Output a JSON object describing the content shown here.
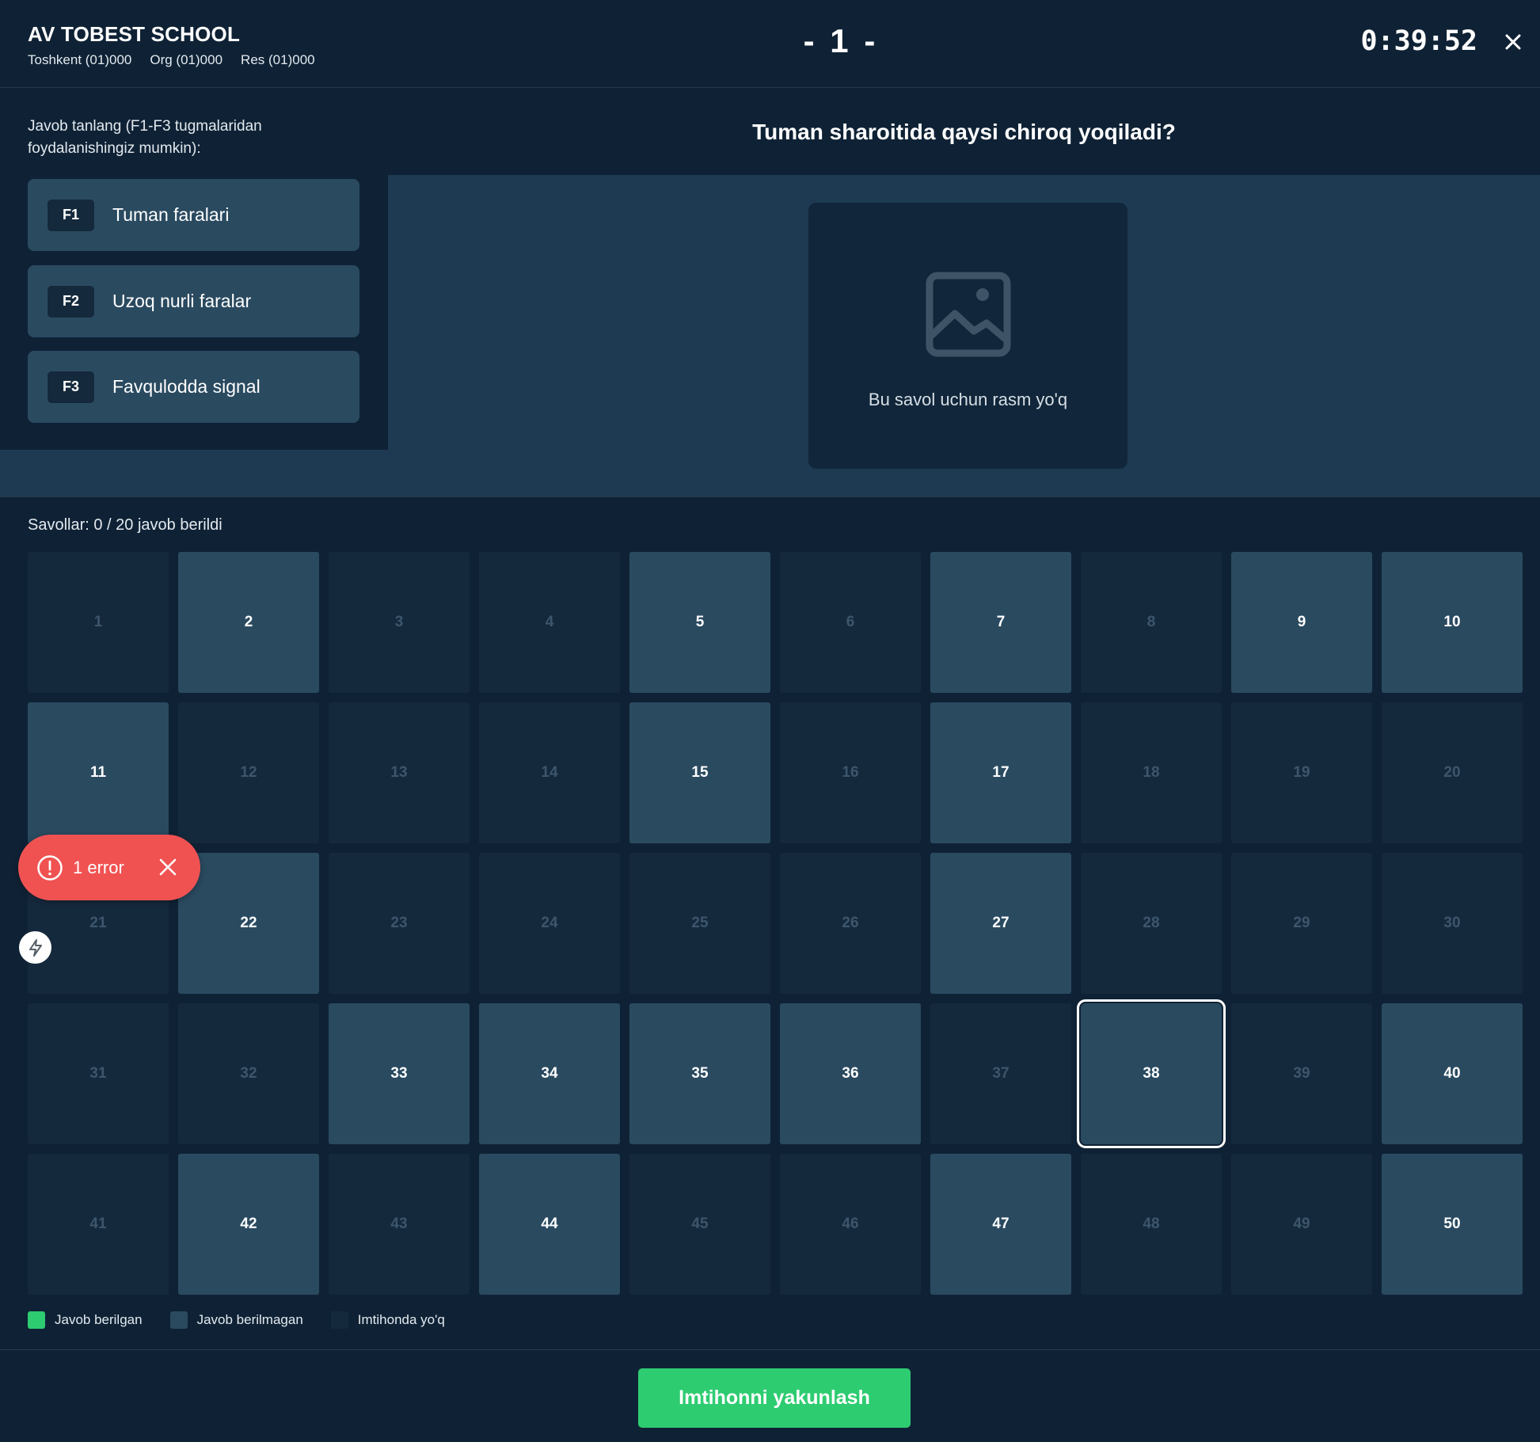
{
  "header": {
    "school_name": "AV TOBEST SCHOOL",
    "info": [
      "Toshkent (01)000",
      "Org (01)000",
      "Res (01)000"
    ],
    "question_number": "- 1 -",
    "timer": "0:39:52"
  },
  "answers": {
    "hint": "Javob tanlang (F1-F3 tugmalaridan foydalanishingiz mumkin):",
    "options": [
      {
        "key": "F1",
        "label": "Tuman faralari"
      },
      {
        "key": "F2",
        "label": "Uzoq nurli faralar"
      },
      {
        "key": "F3",
        "label": "Favqulodda signal"
      }
    ]
  },
  "question": {
    "text": "Tuman sharoitida qaysi chiroq yoqiladi?",
    "image_placeholder": "Bu savol uchun rasm yo'q",
    "image_icon": "image-icon"
  },
  "grid": {
    "progress_text": "Savollar: 0 / 20 javob berildi",
    "current": 38,
    "cells": [
      {
        "n": "1",
        "state": "absent"
      },
      {
        "n": "2",
        "state": "unanswered"
      },
      {
        "n": "3",
        "state": "absent"
      },
      {
        "n": "4",
        "state": "absent"
      },
      {
        "n": "5",
        "state": "unanswered"
      },
      {
        "n": "6",
        "state": "absent"
      },
      {
        "n": "7",
        "state": "unanswered"
      },
      {
        "n": "8",
        "state": "absent"
      },
      {
        "n": "9",
        "state": "unanswered"
      },
      {
        "n": "10",
        "state": "unanswered"
      },
      {
        "n": "11",
        "state": "unanswered"
      },
      {
        "n": "12",
        "state": "absent"
      },
      {
        "n": "13",
        "state": "absent"
      },
      {
        "n": "14",
        "state": "absent"
      },
      {
        "n": "15",
        "state": "unanswered"
      },
      {
        "n": "16",
        "state": "absent"
      },
      {
        "n": "17",
        "state": "unanswered"
      },
      {
        "n": "18",
        "state": "absent"
      },
      {
        "n": "19",
        "state": "absent"
      },
      {
        "n": "20",
        "state": "absent"
      },
      {
        "n": "21",
        "state": "absent"
      },
      {
        "n": "22",
        "state": "unanswered"
      },
      {
        "n": "23",
        "state": "absent"
      },
      {
        "n": "24",
        "state": "absent"
      },
      {
        "n": "25",
        "state": "absent"
      },
      {
        "n": "26",
        "state": "absent"
      },
      {
        "n": "27",
        "state": "unanswered"
      },
      {
        "n": "28",
        "state": "absent"
      },
      {
        "n": "29",
        "state": "absent"
      },
      {
        "n": "30",
        "state": "absent"
      },
      {
        "n": "31",
        "state": "absent"
      },
      {
        "n": "32",
        "state": "absent"
      },
      {
        "n": "33",
        "state": "unanswered"
      },
      {
        "n": "34",
        "state": "unanswered"
      },
      {
        "n": "35",
        "state": "unanswered"
      },
      {
        "n": "36",
        "state": "unanswered"
      },
      {
        "n": "37",
        "state": "absent"
      },
      {
        "n": "38",
        "state": "unanswered"
      },
      {
        "n": "39",
        "state": "absent"
      },
      {
        "n": "40",
        "state": "unanswered"
      },
      {
        "n": "41",
        "state": "absent"
      },
      {
        "n": "42",
        "state": "unanswered"
      },
      {
        "n": "43",
        "state": "absent"
      },
      {
        "n": "44",
        "state": "unanswered"
      },
      {
        "n": "45",
        "state": "absent"
      },
      {
        "n": "46",
        "state": "absent"
      },
      {
        "n": "47",
        "state": "unanswered"
      },
      {
        "n": "48",
        "state": "absent"
      },
      {
        "n": "49",
        "state": "absent"
      },
      {
        "n": "50",
        "state": "unanswered"
      }
    ]
  },
  "legend": [
    {
      "label": "Javob berilgan",
      "color": "#2ecc71"
    },
    {
      "label": "Javob berilmagan",
      "color": "#2a4a60"
    },
    {
      "label": "Imtihonda yo'q",
      "color": "#15293c"
    }
  ],
  "footer": {
    "finish_label": "Imtihonni yakunlash"
  },
  "toast": {
    "text": "1 error",
    "icon": "alert-circle-icon",
    "close_icon": "close-icon"
  },
  "colors": {
    "background": "#0f2235",
    "accent_green": "#2ecc71",
    "error_red": "#f05252"
  }
}
